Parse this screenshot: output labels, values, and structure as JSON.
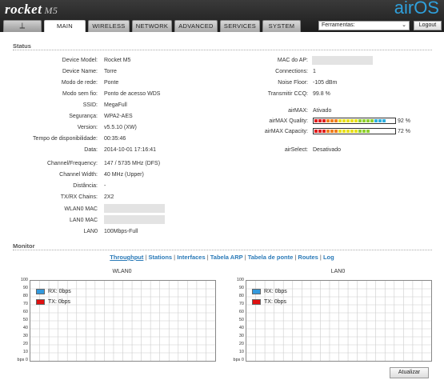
{
  "header": {
    "product": "rocket",
    "model": "M5",
    "brand": "airOS",
    "tabs": [
      "MAIN",
      "WIRELESS",
      "NETWORK",
      "ADVANCED",
      "SERVICES",
      "SYSTEM"
    ],
    "tools_select": "Ferramentas:",
    "logout": "Logout"
  },
  "status": {
    "title": "Status",
    "left": [
      {
        "label": "Device Model:",
        "value": "Rocket M5"
      },
      {
        "label": "Device Name:",
        "value": "Torre"
      },
      {
        "label": "Modo de rede:",
        "value": "Ponte"
      },
      {
        "label": "Modo sem fio:",
        "value": "Ponto de acesso WDS"
      },
      {
        "label": "SSID:",
        "value": "MegaFull"
      },
      {
        "label": "Segurança:",
        "value": "WPA2-AES"
      },
      {
        "label": "Version:",
        "value": "v5.5.10 (XW)"
      },
      {
        "label": "Tempo de disponibilidade:",
        "value": "00:35:46"
      },
      {
        "label": "Data:",
        "value": "2014-10-01 17:16:41"
      },
      {
        "label": "Channel/Frequency:",
        "value": "147 / 5735 MHz (DFS)"
      },
      {
        "label": "Channel Width:",
        "value": "40 MHz (Upper)"
      },
      {
        "label": "Distância:",
        "value": "-"
      },
      {
        "label": "TX/RX Chains:",
        "value": "2X2"
      },
      {
        "label": "WLAN0 MAC",
        "value": ""
      },
      {
        "label": "LAN0 MAC",
        "value": ""
      },
      {
        "label": "LAN0",
        "value": "100Mbps-Full"
      }
    ],
    "right": [
      {
        "label": "MAC do AP:",
        "value": ""
      },
      {
        "label": "Connections:",
        "value": "1"
      },
      {
        "label": "Noise Floor:",
        "value": "-105 dBm"
      },
      {
        "label": "Transmitir CCQ:",
        "value": "99.8 %"
      },
      {
        "label": "airMAX:",
        "value": "Ativado"
      },
      {
        "label": "airMAX Quality:",
        "value": "92 %"
      },
      {
        "label": "airMAX Capacity:",
        "value": "72 %"
      },
      {
        "label": "airSelect:",
        "value": "Desativado"
      }
    ],
    "quality_fraction": 0.92,
    "capacity_fraction": 0.72
  },
  "monitor": {
    "title": "Monitor",
    "links": [
      "Throughput",
      "Stations",
      "Interfaces",
      "Tabela ARP",
      "Tabela de ponte",
      "Routes",
      "Log"
    ],
    "charts": [
      {
        "title": "WLAN0",
        "y_ticks": [
          "100",
          "90",
          "80",
          "70",
          "60",
          "50",
          "40",
          "30",
          "20",
          "10",
          "bps 0"
        ],
        "rx": "RX: 0bps",
        "tx": "TX: 0bps"
      },
      {
        "title": "LAN0",
        "y_ticks": [
          "100",
          "90",
          "80",
          "70",
          "60",
          "50",
          "40",
          "30",
          "20",
          "10",
          "bps 0"
        ],
        "rx": "RX: 0bps",
        "tx": "TX: 0bps"
      }
    ],
    "rx_color": "#3399dd",
    "tx_color": "#e01010",
    "refresh": "Atualizar"
  }
}
